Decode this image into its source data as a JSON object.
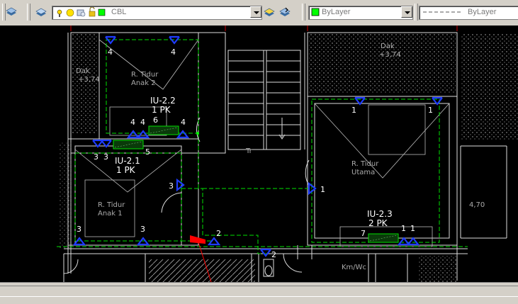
{
  "toolbar": {
    "layer_name": "CBL",
    "color_value": "ByLayer",
    "linetype_value": "ByLayer"
  },
  "drawing": {
    "rooms": {
      "anak2_line1": "R. Tidur",
      "anak2_line2": "Anak 2",
      "anak1_line1": "R. Tidur",
      "anak1_line2": "Anak 1",
      "utama_line1": "R. Tidur",
      "utama_line2": "Utama",
      "kmwc": "Km/Wc",
      "tr": "Tr"
    },
    "dak_left_line1": "Dak",
    "dak_left_line2": "+3,74",
    "dak_right_line1": "Dak",
    "dak_right_line2": "+3,74",
    "dimension": "4,70",
    "units": [
      {
        "name": "IU-2.2",
        "capacity": "1 PK"
      },
      {
        "name": "IU-2.1",
        "capacity": "1 PK"
      },
      {
        "name": "IU-2.3",
        "capacity": "2 PK"
      }
    ],
    "unit_numbers": {
      "iu22": "6",
      "iu21": "5",
      "iu23": "7"
    },
    "light_numbers": {
      "a2_left": "4",
      "a2_right": "4",
      "a2_b1": "4",
      "a2_b2": "4",
      "a2_b3": "4",
      "a1_1": "3",
      "a1_2": "3",
      "a1_3": "3",
      "a1_bl": "3",
      "a1_bm": "3",
      "ut_1": "1",
      "ut_2": "1",
      "ut_3": "1",
      "ut_b1": "1",
      "ut_b2": "1",
      "hall": "2",
      "hall2": "2"
    }
  }
}
